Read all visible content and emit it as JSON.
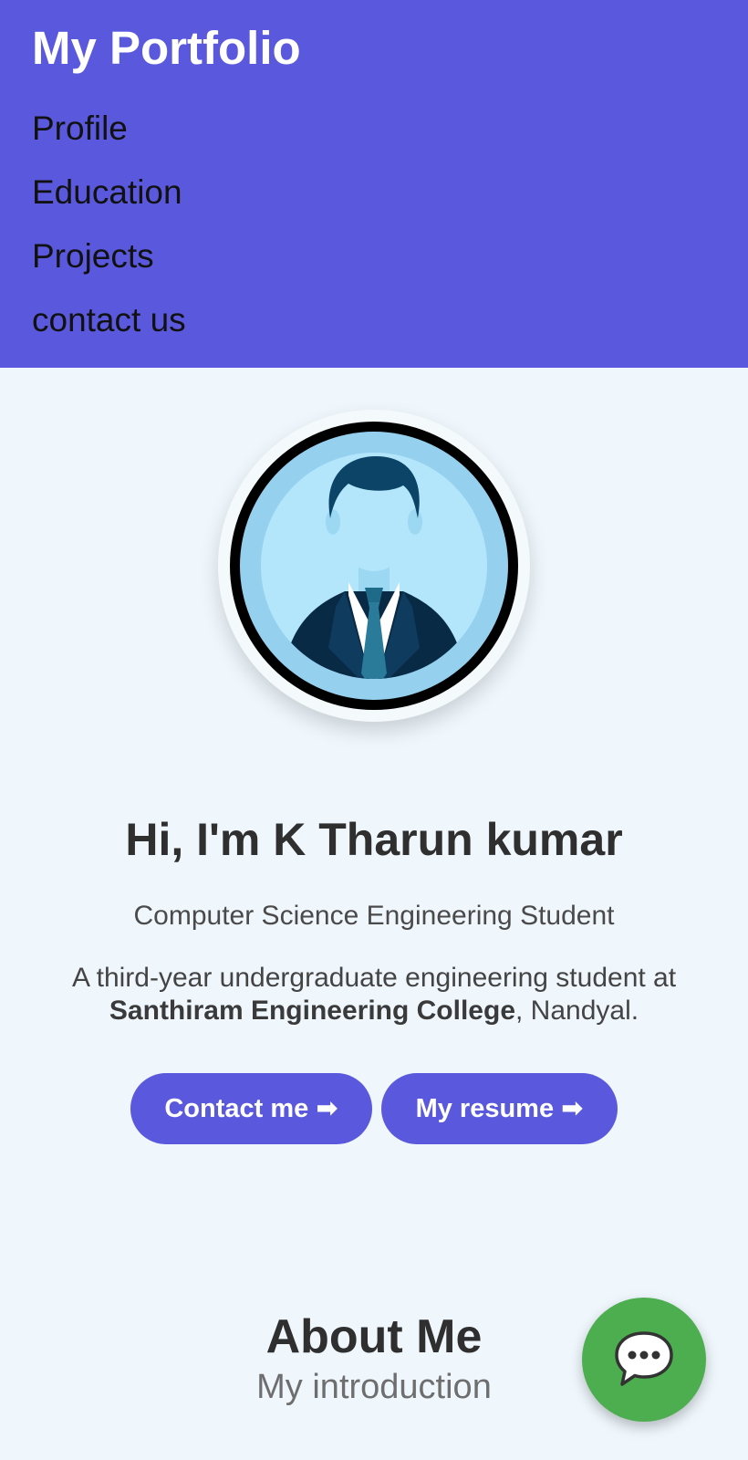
{
  "header": {
    "brand": "My Portfolio",
    "nav": [
      "Profile",
      "Education",
      "Projects",
      "contact us"
    ],
    "color": "#5a59dd"
  },
  "hero": {
    "avatar_icon": "student-avatar-icon",
    "title": "Hi, I'm K Tharun kumar",
    "subtitle": "Computer Science Engineering Student",
    "desc_prefix": "A third-year undergraduate engineering student at",
    "college": "Santhiram Engineering College",
    "desc_suffix": ", Nandyal.",
    "buttons": {
      "contact": "Contact me ➡",
      "resume": "My resume ➡"
    }
  },
  "about": {
    "title": "About Me",
    "subtitle": "My introduction"
  },
  "chat": {
    "icon": "chat-bubble-icon",
    "color": "#4cae4f"
  }
}
